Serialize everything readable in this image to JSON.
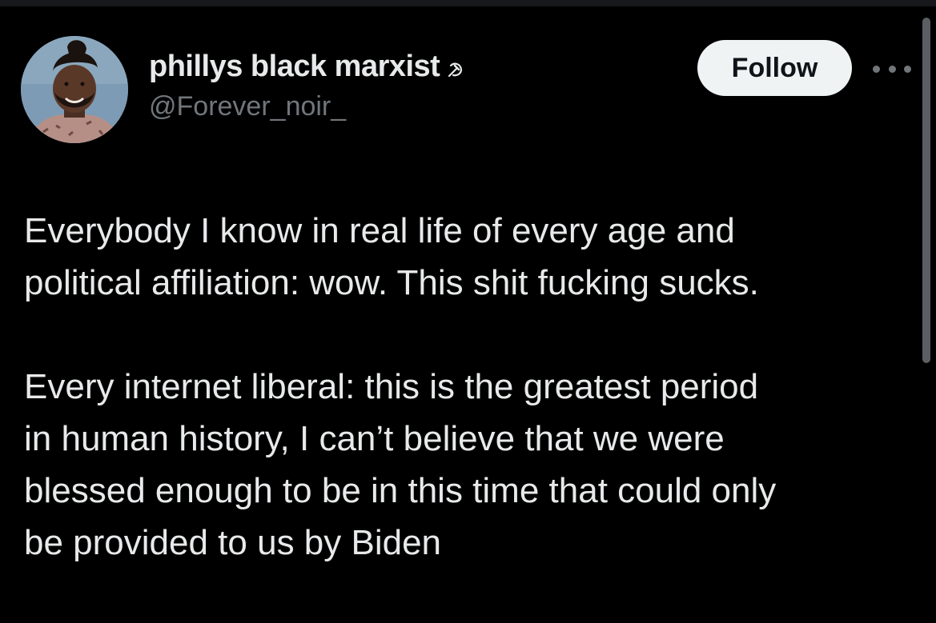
{
  "author": {
    "display_name": "phillys black marxist",
    "name_icon": "hammer-and-sickle-icon",
    "handle": "@Forever_noir_"
  },
  "actions": {
    "follow_label": "Follow",
    "more_icon": "more-options-icon"
  },
  "tweet": {
    "paragraphs": [
      "Everybody I know in real life of every age and\npolitical affiliation: wow. This shit fucking sucks.",
      "Every internet liberal: this is the greatest period\nin human history, I can’t believe that we were\nblessed enough to be in this time that could only\nbe provided to us by Biden"
    ]
  },
  "colors": {
    "background": "#000000",
    "text_primary": "#e7e9ea",
    "text_secondary": "#71767b",
    "follow_button_bg": "#eff3f4"
  }
}
